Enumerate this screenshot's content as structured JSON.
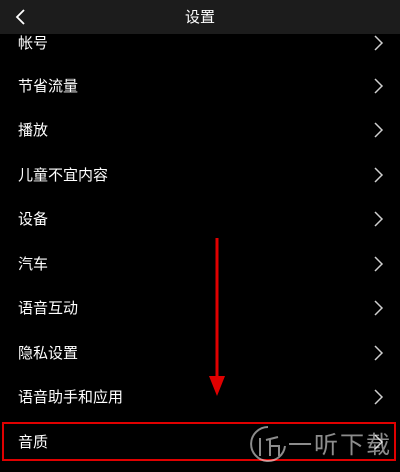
{
  "header": {
    "title": "设置",
    "back_icon": "chevron-left-icon"
  },
  "settings": {
    "items": [
      {
        "label": "帐号"
      },
      {
        "label": "节省流量"
      },
      {
        "label": "播放"
      },
      {
        "label": "儿童不宜内容"
      },
      {
        "label": "设备"
      },
      {
        "label": "汽车"
      },
      {
        "label": "语音互动"
      },
      {
        "label": "隐私设置"
      },
      {
        "label": "语音助手和应用"
      },
      {
        "label": "音质"
      }
    ],
    "chevron_icon": "chevron-right-icon"
  },
  "annotation": {
    "highlight_color": "#e00000",
    "highlighted_item": "音质"
  },
  "watermark": {
    "text": "一听下载"
  }
}
